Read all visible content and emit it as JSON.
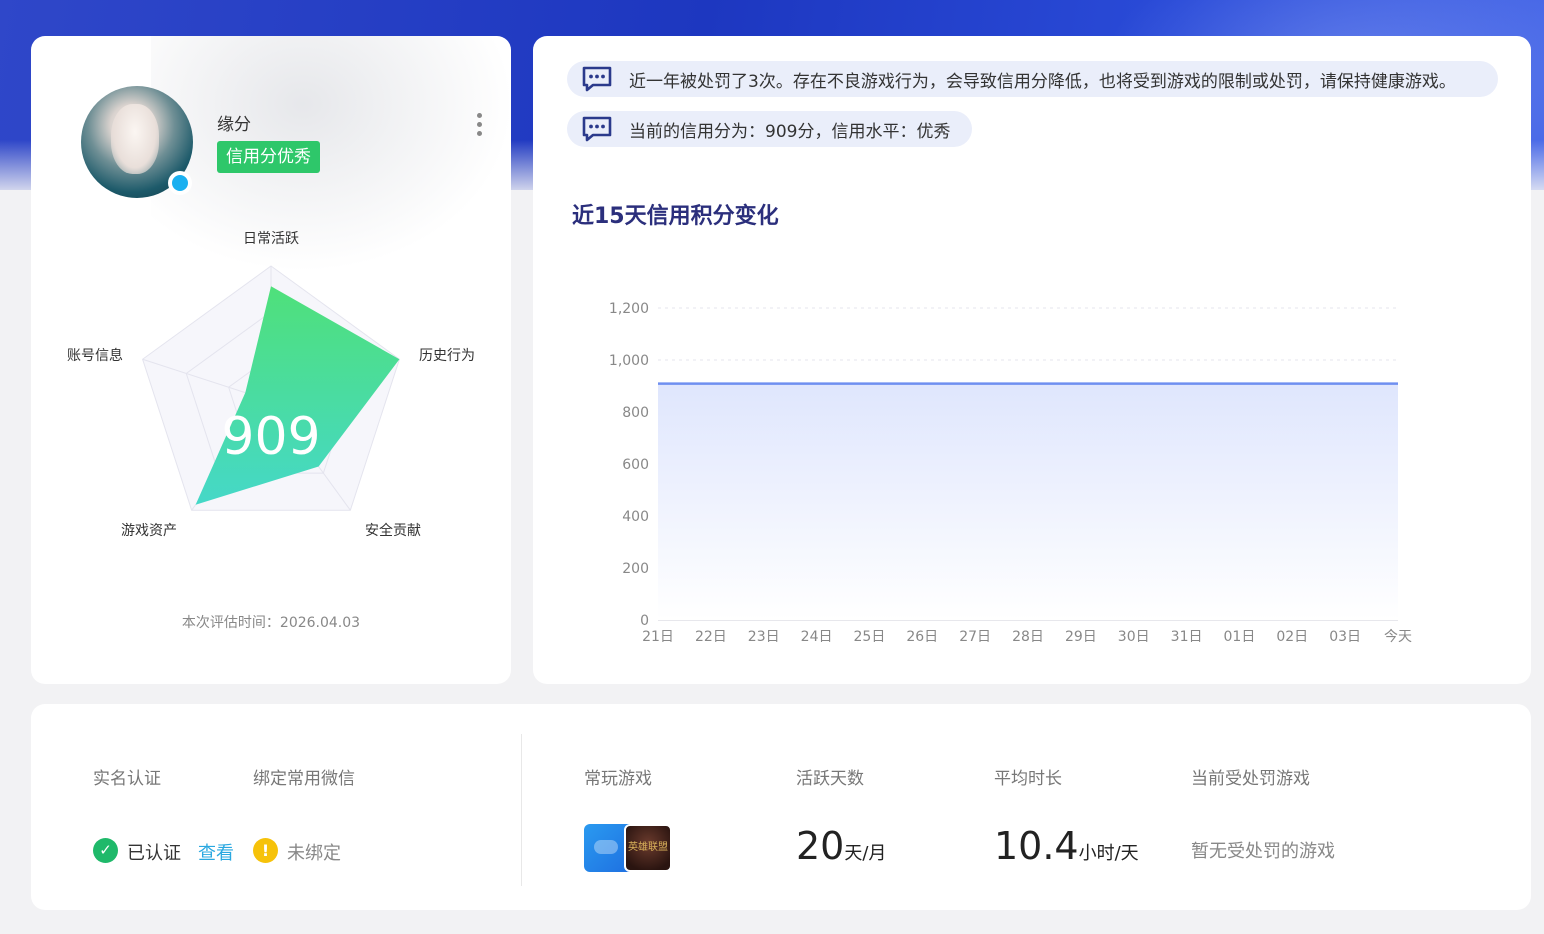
{
  "profile": {
    "nickname": "缘分",
    "credit_tag": "信用分优秀",
    "score": "909",
    "eval_time": "本次评估时间：2026.04.03",
    "radar": {
      "axes": [
        "日常活跃",
        "历史行为",
        "安全贡献",
        "游戏资产",
        "账号信息"
      ],
      "values": [
        0.85,
        1.0,
        0.6,
        0.95,
        0.2
      ],
      "fill_top": "#4fe07a",
      "fill_bottom": "#45d8c8"
    }
  },
  "notices": [
    "近一年被处罚了3次。存在不良游戏行为，会导致信用分降低，也将受到游戏的限制或处罚，请保持健康游戏。",
    "当前的信用分为：909分，信用水平：优秀"
  ],
  "chart_title": "近15天信用积分变化",
  "chart_data": {
    "type": "area",
    "categories": [
      "21日",
      "22日",
      "23日",
      "24日",
      "25日",
      "26日",
      "27日",
      "28日",
      "29日",
      "30日",
      "31日",
      "01日",
      "02日",
      "03日",
      "今天"
    ],
    "y_ticks": [
      "0",
      "200",
      "400",
      "600",
      "800",
      "1,000",
      "1,200"
    ],
    "series": [
      {
        "values": [
          909,
          909,
          909,
          909,
          909,
          909,
          909,
          909,
          909,
          909,
          909,
          909,
          909,
          909,
          909
        ]
      }
    ],
    "ylim": [
      0,
      1200
    ],
    "line_color": "#6f8ff0",
    "fill_color": "#dfe6fd"
  },
  "bottom": {
    "real_name_label": "实名认证",
    "wechat_label": "绑定常用微信",
    "verified_text": "已认证",
    "view_link": "查看",
    "unbound_text": "未绑定",
    "check_glyph": "✓",
    "warn_glyph": "!",
    "games_label": "常玩游戏",
    "game2_text": "英雄联盟",
    "active_days_label": "活跃天数",
    "active_days_value": "20",
    "active_days_unit": "天/月",
    "avg_time_label": "平均时长",
    "avg_time_value": "10.4",
    "avg_time_unit": "小时/天",
    "punish_label": "当前受处罚游戏",
    "punish_value": "暂无受处罚的游戏"
  }
}
